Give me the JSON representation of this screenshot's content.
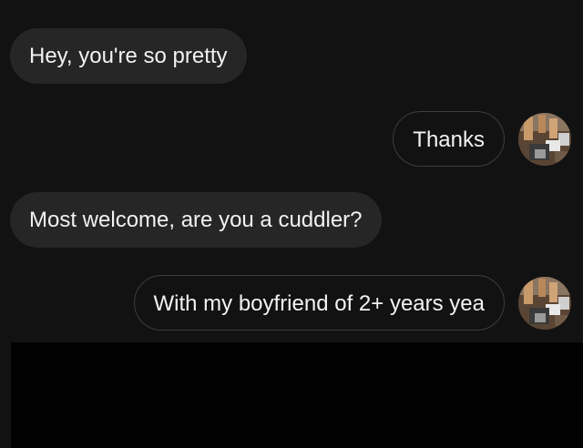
{
  "messages": [
    {
      "direction": "incoming",
      "text": "Hey, you're so pretty"
    },
    {
      "direction": "outgoing",
      "text": "Thanks",
      "avatar": "profile-photo-icon"
    },
    {
      "direction": "incoming",
      "text": "Most welcome, are you a cuddler?"
    },
    {
      "direction": "outgoing",
      "text": "With my boyfriend of 2+ years yea",
      "avatar": "profile-photo-icon"
    }
  ],
  "colors": {
    "background": "#121212",
    "incoming_bubble": "#262626",
    "outgoing_border": "#3d3d3d",
    "text": "#f2f2f2",
    "redaction": "#020202"
  }
}
